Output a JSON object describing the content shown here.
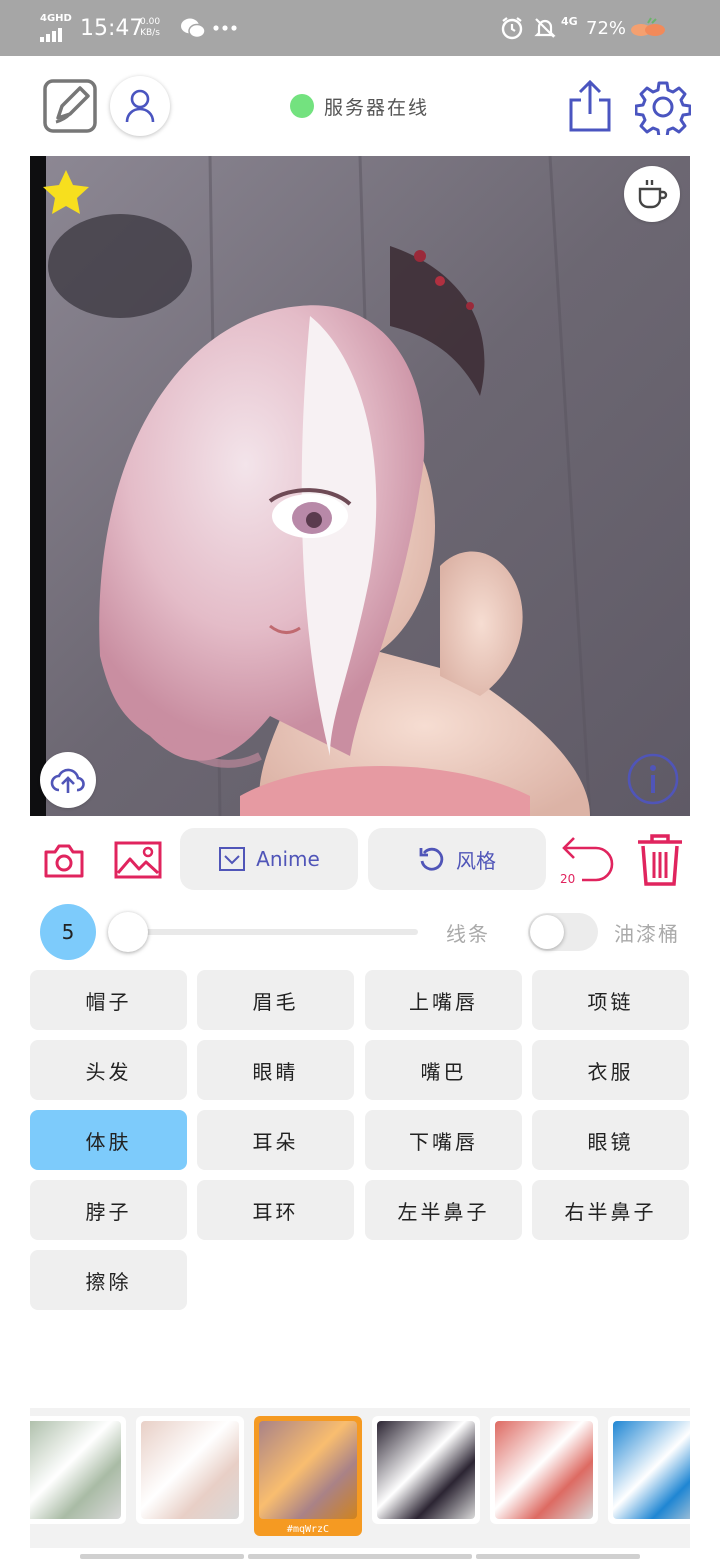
{
  "status_bar": {
    "network_label": "4GHD",
    "time": "15:47",
    "speed_value": "0.00",
    "speed_unit": "KB/s",
    "network_right": "4G",
    "battery": "72%"
  },
  "header": {
    "server_status": "服务器在线"
  },
  "toolbar": {
    "model_label": "Anime",
    "style_label": "风格",
    "undo_count": "20"
  },
  "brush": {
    "size": "5",
    "size_fraction": 0.0,
    "line_label": "线条",
    "bucket_label": "油漆桶",
    "bucket_enabled": false
  },
  "labels": [
    {
      "text": "帽子",
      "active": false
    },
    {
      "text": "眉毛",
      "active": false
    },
    {
      "text": "上嘴唇",
      "active": false
    },
    {
      "text": "项链",
      "active": false
    },
    {
      "text": "头发",
      "active": false
    },
    {
      "text": "眼睛",
      "active": false
    },
    {
      "text": "嘴巴",
      "active": false
    },
    {
      "text": "衣服",
      "active": false
    },
    {
      "text": "体肤",
      "active": true
    },
    {
      "text": "耳朵",
      "active": false
    },
    {
      "text": "下嘴唇",
      "active": false
    },
    {
      "text": "眼镜",
      "active": false
    },
    {
      "text": "脖子",
      "active": false
    },
    {
      "text": "耳环",
      "active": false
    },
    {
      "text": "左半鼻子",
      "active": false
    },
    {
      "text": "右半鼻子",
      "active": false
    },
    {
      "text": "擦除",
      "active": false
    }
  ],
  "styles": [
    {
      "name": "green-grey-texture",
      "color": "#a9bba5"
    },
    {
      "name": "beige-texture",
      "color": "#e8cfc6"
    },
    {
      "name": "rose-lace-texture",
      "color": "#a98287",
      "code": "#mqWrzC",
      "selected": true
    },
    {
      "name": "dark-purple-texture",
      "color": "#2c2533"
    },
    {
      "name": "coral-red-texture",
      "color": "#dd6a62"
    },
    {
      "name": "blue-water-texture",
      "color": "#1f86d3"
    }
  ],
  "colors": {
    "accent_pink": "#e0245e",
    "accent_purple": "#5055b8",
    "active_blue": "#7dcbfb",
    "online_green": "#73e27f",
    "selected_orange": "#f59a22"
  }
}
